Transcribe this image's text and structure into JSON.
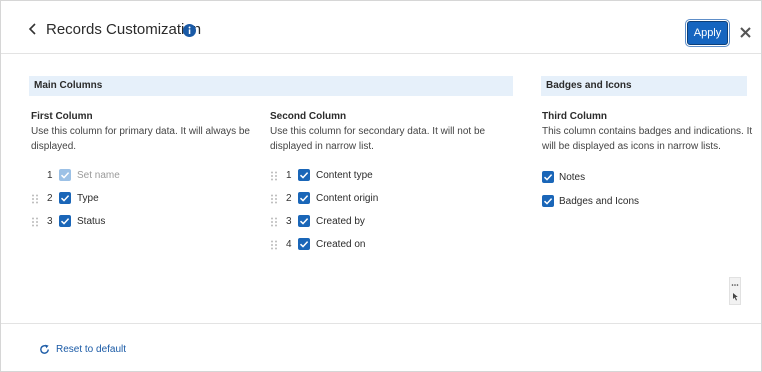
{
  "header": {
    "title": "Records Customization",
    "apply_label": "Apply",
    "back_icon": "chevron-left-icon",
    "info_icon": "info-icon",
    "close_icon": "close-icon"
  },
  "sections": {
    "main_columns": "Main Columns",
    "badges_and_icons": "Badges and Icons"
  },
  "columns": {
    "first": {
      "title": "First Column",
      "description": "Use this column for primary data. It will always be displayed.",
      "items": [
        {
          "number": "1",
          "label": "Set name",
          "checked": true,
          "disabled": true,
          "draggable": false
        },
        {
          "number": "2",
          "label": "Type",
          "checked": true,
          "disabled": false,
          "draggable": true
        },
        {
          "number": "3",
          "label": "Status",
          "checked": true,
          "disabled": false,
          "draggable": true
        }
      ]
    },
    "second": {
      "title": "Second Column",
      "description": "Use this column for secondary data. It will not be displayed in narrow list.",
      "items": [
        {
          "number": "1",
          "label": "Content type",
          "checked": true,
          "disabled": false,
          "draggable": true
        },
        {
          "number": "2",
          "label": "Content origin",
          "checked": true,
          "disabled": false,
          "draggable": true
        },
        {
          "number": "3",
          "label": "Created by",
          "checked": true,
          "disabled": false,
          "draggable": true
        },
        {
          "number": "4",
          "label": "Created on",
          "checked": true,
          "disabled": false,
          "draggable": true
        }
      ]
    },
    "third": {
      "title": "Third Column",
      "description": "This column contains badges and indications. It will be displayed as icons in narrow lists.",
      "items": [
        {
          "label": "Notes",
          "checked": true
        },
        {
          "label": "Badges and Icons",
          "checked": true
        }
      ]
    }
  },
  "footer": {
    "reset_label": "Reset to default",
    "reset_icon": "refresh-icon"
  },
  "colors": {
    "accent": "#1565c0",
    "band_bg": "#e6f0fa",
    "checkbox": "#1a66b8",
    "checkbox_disabled": "#9cc1e6",
    "link": "#1a5aa6"
  }
}
